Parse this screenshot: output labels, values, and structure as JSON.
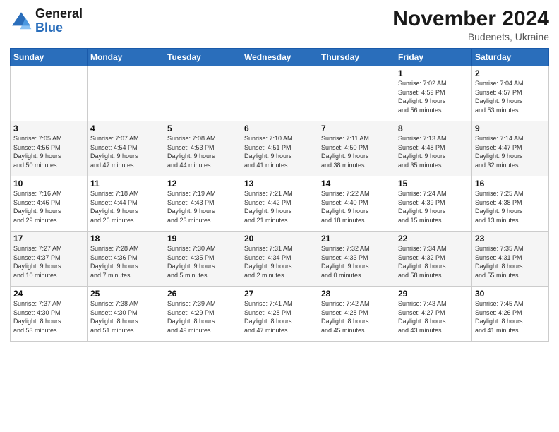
{
  "logo": {
    "line1": "General",
    "line2": "Blue"
  },
  "title": "November 2024",
  "location": "Budenets, Ukraine",
  "days_header": [
    "Sunday",
    "Monday",
    "Tuesday",
    "Wednesday",
    "Thursday",
    "Friday",
    "Saturday"
  ],
  "weeks": [
    [
      {
        "day": "",
        "info": ""
      },
      {
        "day": "",
        "info": ""
      },
      {
        "day": "",
        "info": ""
      },
      {
        "day": "",
        "info": ""
      },
      {
        "day": "",
        "info": ""
      },
      {
        "day": "1",
        "info": "Sunrise: 7:02 AM\nSunset: 4:59 PM\nDaylight: 9 hours\nand 56 minutes."
      },
      {
        "day": "2",
        "info": "Sunrise: 7:04 AM\nSunset: 4:57 PM\nDaylight: 9 hours\nand 53 minutes."
      }
    ],
    [
      {
        "day": "3",
        "info": "Sunrise: 7:05 AM\nSunset: 4:56 PM\nDaylight: 9 hours\nand 50 minutes."
      },
      {
        "day": "4",
        "info": "Sunrise: 7:07 AM\nSunset: 4:54 PM\nDaylight: 9 hours\nand 47 minutes."
      },
      {
        "day": "5",
        "info": "Sunrise: 7:08 AM\nSunset: 4:53 PM\nDaylight: 9 hours\nand 44 minutes."
      },
      {
        "day": "6",
        "info": "Sunrise: 7:10 AM\nSunset: 4:51 PM\nDaylight: 9 hours\nand 41 minutes."
      },
      {
        "day": "7",
        "info": "Sunrise: 7:11 AM\nSunset: 4:50 PM\nDaylight: 9 hours\nand 38 minutes."
      },
      {
        "day": "8",
        "info": "Sunrise: 7:13 AM\nSunset: 4:48 PM\nDaylight: 9 hours\nand 35 minutes."
      },
      {
        "day": "9",
        "info": "Sunrise: 7:14 AM\nSunset: 4:47 PM\nDaylight: 9 hours\nand 32 minutes."
      }
    ],
    [
      {
        "day": "10",
        "info": "Sunrise: 7:16 AM\nSunset: 4:46 PM\nDaylight: 9 hours\nand 29 minutes."
      },
      {
        "day": "11",
        "info": "Sunrise: 7:18 AM\nSunset: 4:44 PM\nDaylight: 9 hours\nand 26 minutes."
      },
      {
        "day": "12",
        "info": "Sunrise: 7:19 AM\nSunset: 4:43 PM\nDaylight: 9 hours\nand 23 minutes."
      },
      {
        "day": "13",
        "info": "Sunrise: 7:21 AM\nSunset: 4:42 PM\nDaylight: 9 hours\nand 21 minutes."
      },
      {
        "day": "14",
        "info": "Sunrise: 7:22 AM\nSunset: 4:40 PM\nDaylight: 9 hours\nand 18 minutes."
      },
      {
        "day": "15",
        "info": "Sunrise: 7:24 AM\nSunset: 4:39 PM\nDaylight: 9 hours\nand 15 minutes."
      },
      {
        "day": "16",
        "info": "Sunrise: 7:25 AM\nSunset: 4:38 PM\nDaylight: 9 hours\nand 13 minutes."
      }
    ],
    [
      {
        "day": "17",
        "info": "Sunrise: 7:27 AM\nSunset: 4:37 PM\nDaylight: 9 hours\nand 10 minutes."
      },
      {
        "day": "18",
        "info": "Sunrise: 7:28 AM\nSunset: 4:36 PM\nDaylight: 9 hours\nand 7 minutes."
      },
      {
        "day": "19",
        "info": "Sunrise: 7:30 AM\nSunset: 4:35 PM\nDaylight: 9 hours\nand 5 minutes."
      },
      {
        "day": "20",
        "info": "Sunrise: 7:31 AM\nSunset: 4:34 PM\nDaylight: 9 hours\nand 2 minutes."
      },
      {
        "day": "21",
        "info": "Sunrise: 7:32 AM\nSunset: 4:33 PM\nDaylight: 9 hours\nand 0 minutes."
      },
      {
        "day": "22",
        "info": "Sunrise: 7:34 AM\nSunset: 4:32 PM\nDaylight: 8 hours\nand 58 minutes."
      },
      {
        "day": "23",
        "info": "Sunrise: 7:35 AM\nSunset: 4:31 PM\nDaylight: 8 hours\nand 55 minutes."
      }
    ],
    [
      {
        "day": "24",
        "info": "Sunrise: 7:37 AM\nSunset: 4:30 PM\nDaylight: 8 hours\nand 53 minutes."
      },
      {
        "day": "25",
        "info": "Sunrise: 7:38 AM\nSunset: 4:30 PM\nDaylight: 8 hours\nand 51 minutes."
      },
      {
        "day": "26",
        "info": "Sunrise: 7:39 AM\nSunset: 4:29 PM\nDaylight: 8 hours\nand 49 minutes."
      },
      {
        "day": "27",
        "info": "Sunrise: 7:41 AM\nSunset: 4:28 PM\nDaylight: 8 hours\nand 47 minutes."
      },
      {
        "day": "28",
        "info": "Sunrise: 7:42 AM\nSunset: 4:28 PM\nDaylight: 8 hours\nand 45 minutes."
      },
      {
        "day": "29",
        "info": "Sunrise: 7:43 AM\nSunset: 4:27 PM\nDaylight: 8 hours\nand 43 minutes."
      },
      {
        "day": "30",
        "info": "Sunrise: 7:45 AM\nSunset: 4:26 PM\nDaylight: 8 hours\nand 41 minutes."
      }
    ]
  ]
}
